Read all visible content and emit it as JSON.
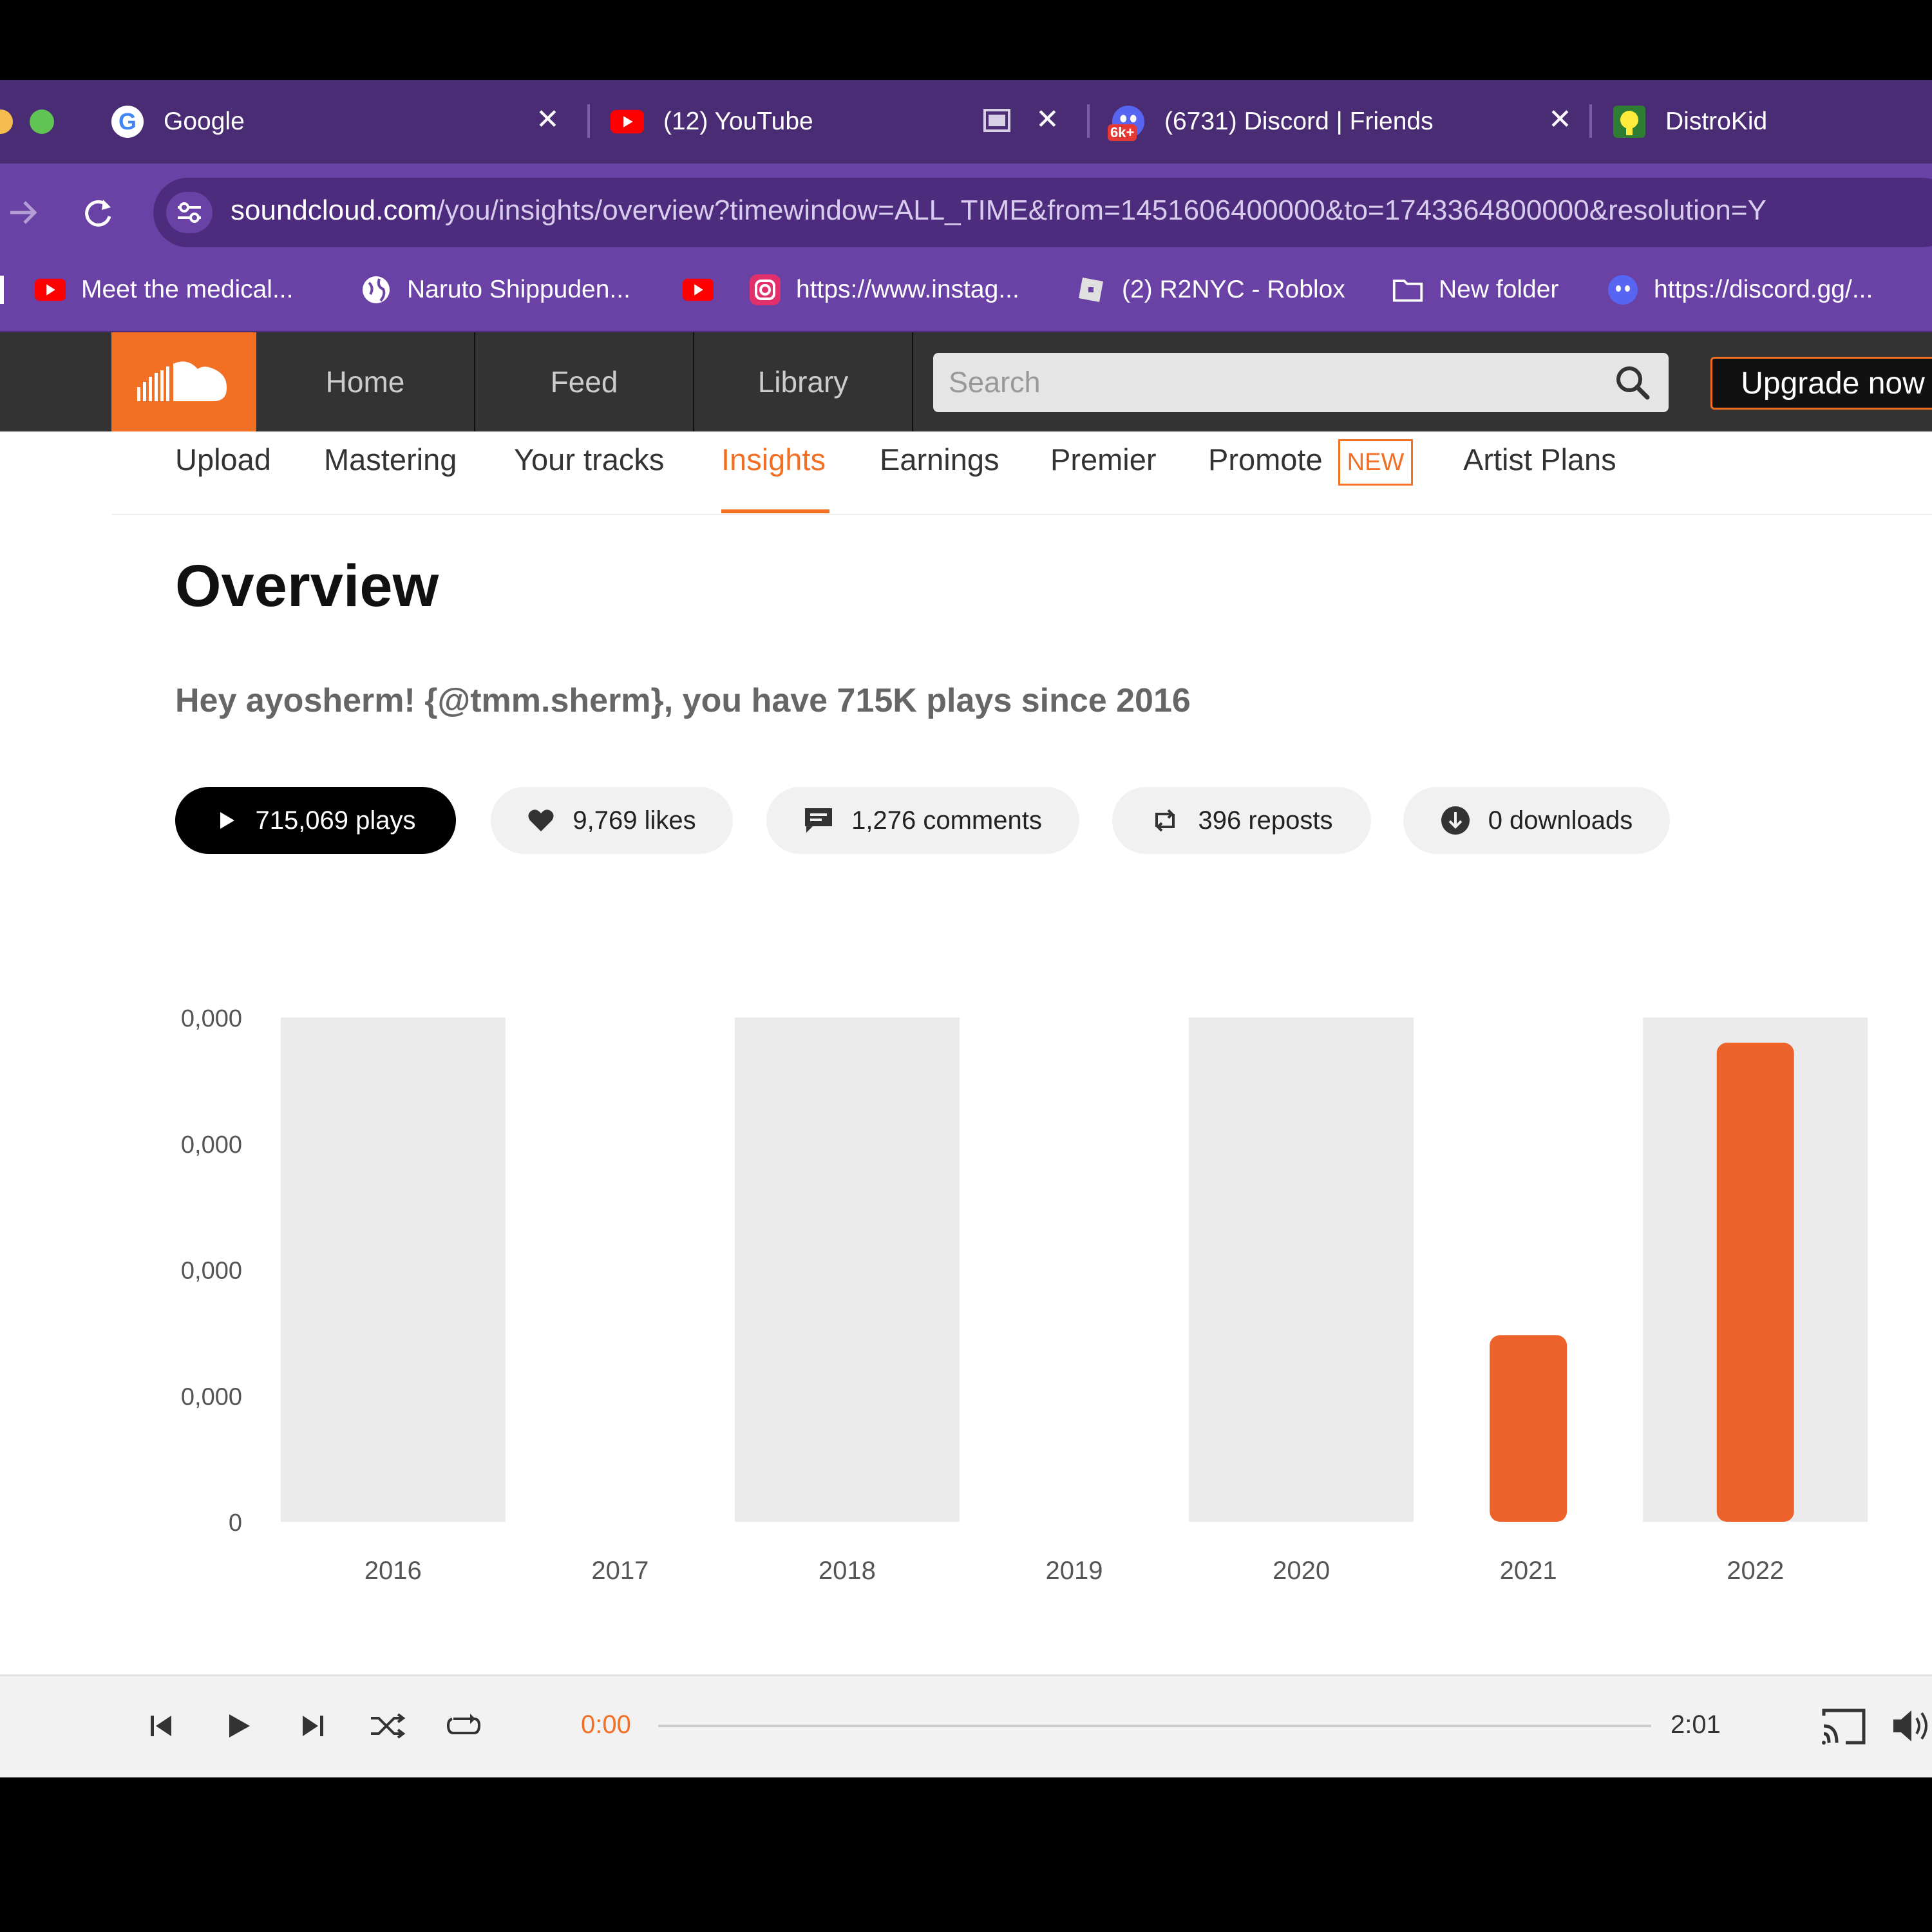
{
  "browser": {
    "tabs": [
      {
        "title": "Google",
        "icon": "google-icon"
      },
      {
        "title": "(12) YouTube",
        "icon": "youtube-icon"
      },
      {
        "title": "(6731) Discord | Friends",
        "icon": "discord-icon",
        "badge": "6k+"
      },
      {
        "title": "DistroKid",
        "icon": "distrokid-icon"
      }
    ],
    "url_host": "soundcloud.com",
    "url_path": "/you/insights/overview?timewindow=ALL_TIME&from=1451606400000&to=1743364800000&resolution=Y",
    "bookmarks": [
      {
        "label": "Meet the medical...",
        "icon": "youtube-icon"
      },
      {
        "label": "Naruto Shippuden...",
        "icon": "globe-icon"
      },
      {
        "label": "",
        "icon": "youtube-icon"
      },
      {
        "label": "https://www.instag...",
        "icon": "instagram-icon"
      },
      {
        "label": "(2) R2NYC - Roblox",
        "icon": "roblox-icon"
      },
      {
        "label": "New folder",
        "icon": "folder-icon"
      },
      {
        "label": "https://discord.gg/...",
        "icon": "discord-icon"
      }
    ]
  },
  "header": {
    "nav": [
      "Home",
      "Feed",
      "Library"
    ],
    "search_placeholder": "Search",
    "upgrade_label": "Upgrade now"
  },
  "subnav": {
    "items": [
      "Upload",
      "Mastering",
      "Your tracks",
      "Insights",
      "Earnings",
      "Premier",
      "Promote",
      "Artist Plans"
    ],
    "active": "Insights",
    "new_badge": "NEW"
  },
  "overview": {
    "title": "Overview",
    "greeting": "Hey ayosherm! {@tmm.sherm}, you have 715K plays since 2016",
    "stats": {
      "plays": "715,069 plays",
      "likes": "9,769 likes",
      "comments": "1,276 comments",
      "reposts": "396 reposts",
      "downloads": "0 downloads"
    }
  },
  "chart_data": {
    "type": "bar",
    "categories": [
      "2016",
      "2017",
      "2018",
      "2019",
      "2020",
      "2021",
      "2022"
    ],
    "values": [
      0,
      0,
      0,
      0,
      0,
      148000,
      380000
    ],
    "y_tick_labels": [
      "0,000",
      "0,000",
      "0,000",
      "0,000",
      "0"
    ],
    "ylim": [
      0,
      400000
    ],
    "colors": {
      "bar": "#ee622c",
      "band": "#ebebeb",
      "text": "#555555"
    }
  },
  "player": {
    "current_time": "0:00",
    "total_time": "2:01",
    "progress": 0
  },
  "colors": {
    "accent": "#f26f23",
    "tabbar": "#4a2c74",
    "toolbar": "#6a42a6"
  }
}
